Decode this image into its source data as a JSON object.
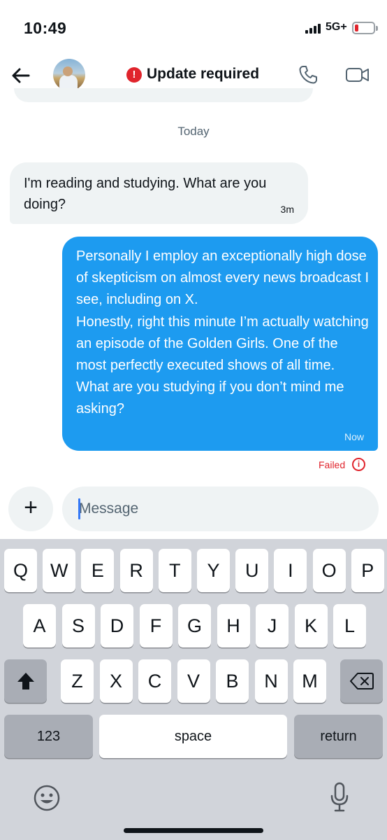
{
  "status_bar": {
    "time": "10:49",
    "network": "5G+",
    "battery_level": 0.15,
    "battery_color": "#e0242c"
  },
  "header": {
    "back_icon": "arrow-left-icon",
    "title": "Update required",
    "alert_icon": "exclamation-circle-icon",
    "alert_color": "#e0242c",
    "call_icon": "phone-icon",
    "video_icon": "video-camera-icon"
  },
  "conversation": {
    "date_divider": "Today",
    "messages": [
      {
        "direction": "incoming",
        "text": "I'm reading and studying. What are you doing?",
        "time": "3m"
      },
      {
        "direction": "outgoing",
        "text": "Personally I employ an exceptionally high dose of skepticism on almost every news broadcast I see, including on X.\nHonestly, right this minute I’m actually watching an episode of the Golden Girls. One of the most perfectly executed shows of all time.\nWhat are you studying if you don’t mind me asking?",
        "time": "Now",
        "status": "Failed"
      }
    ]
  },
  "composer": {
    "add_label": "+",
    "placeholder": "Message"
  },
  "keyboard": {
    "row1": [
      "Q",
      "W",
      "E",
      "R",
      "T",
      "Y",
      "U",
      "I",
      "O",
      "P"
    ],
    "row2": [
      "A",
      "S",
      "D",
      "F",
      "G",
      "H",
      "J",
      "K",
      "L"
    ],
    "row3": [
      "Z",
      "X",
      "C",
      "V",
      "B",
      "N",
      "M"
    ],
    "shift_icon": "shift-arrow-icon",
    "delete_icon": "backspace-icon",
    "numbers_label": "123",
    "space_label": "space",
    "return_label": "return",
    "emoji_icon": "emoji-icon",
    "dictation_icon": "microphone-icon"
  },
  "colors": {
    "accent": "#1d9bf0",
    "incoming_bubble": "#eff3f4",
    "error": "#e0242c",
    "keyboard_bg": "#d1d4da"
  }
}
